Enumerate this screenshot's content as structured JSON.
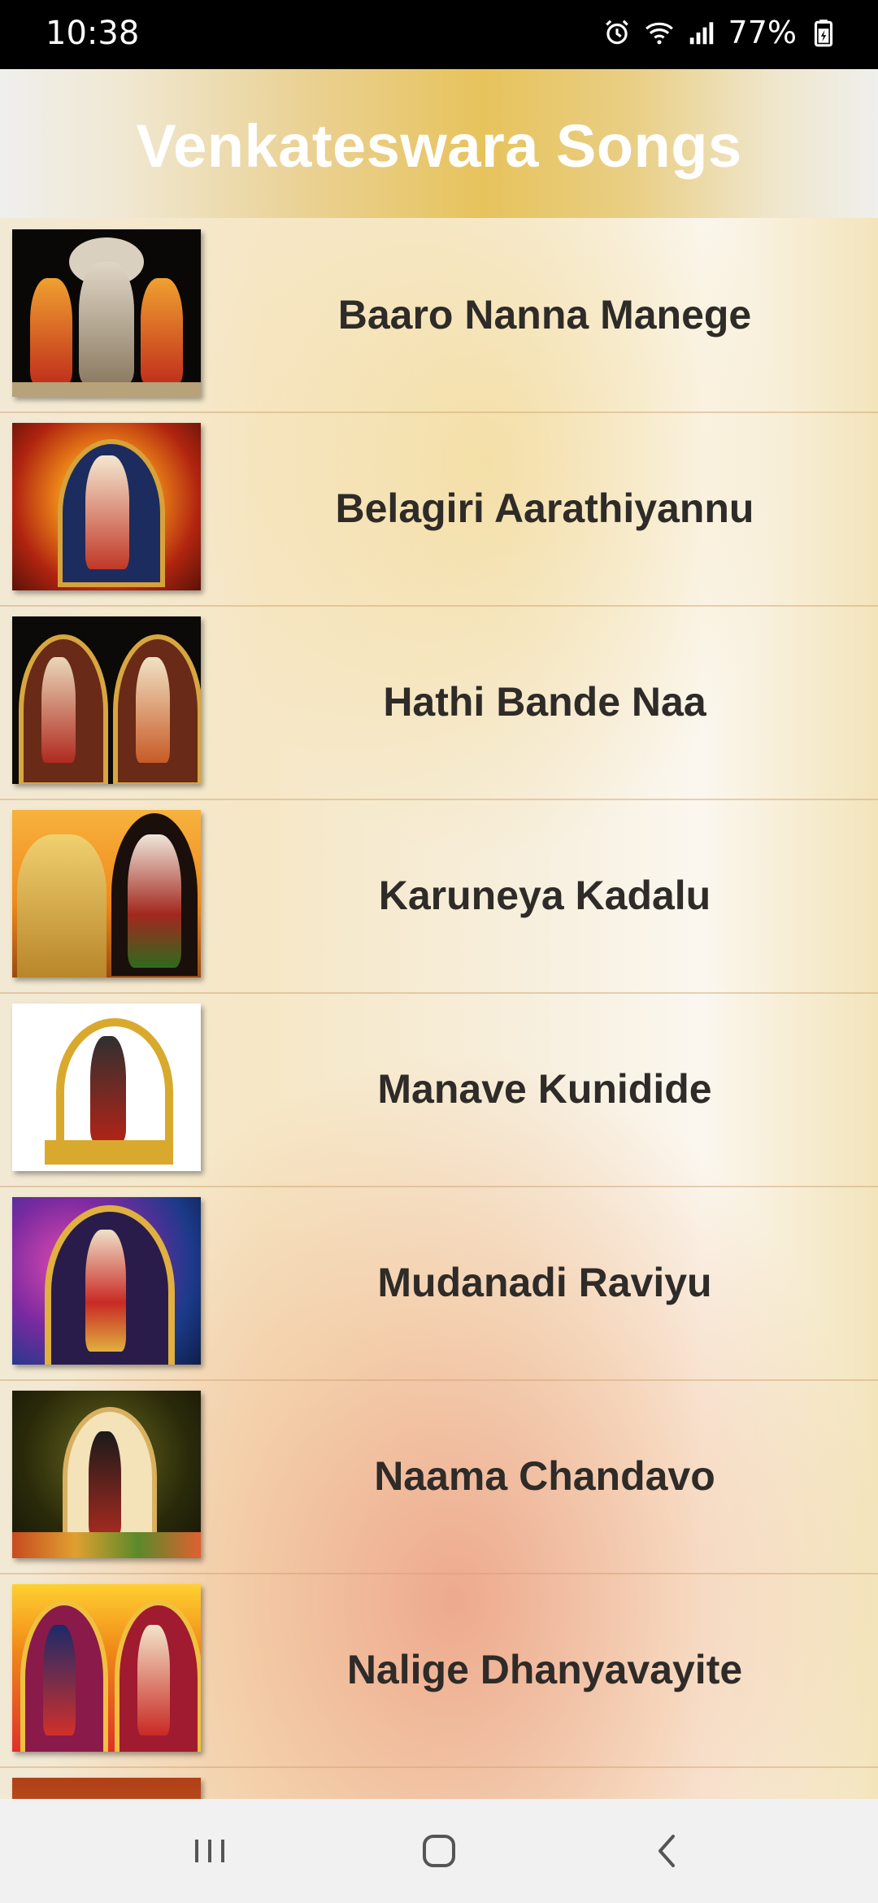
{
  "status_bar": {
    "time": "10:38",
    "battery_text": "77%",
    "icons": [
      "alarm-icon",
      "wifi-icon",
      "signal-icon",
      "battery-icon"
    ]
  },
  "header": {
    "title": "Venkateswara Songs"
  },
  "songs": [
    {
      "title": "Baaro Nanna Manege"
    },
    {
      "title": "Belagiri Aarathiyannu"
    },
    {
      "title": "Hathi Bande Naa"
    },
    {
      "title": "Karuneya Kadalu"
    },
    {
      "title": "Manave Kunidide"
    },
    {
      "title": "Mudanadi Raviyu"
    },
    {
      "title": "Naama Chandavo"
    },
    {
      "title": "Nalige Dhanyavayite"
    }
  ],
  "nav_bar": {
    "buttons": [
      "recent-apps-icon",
      "home-icon",
      "back-icon"
    ]
  }
}
